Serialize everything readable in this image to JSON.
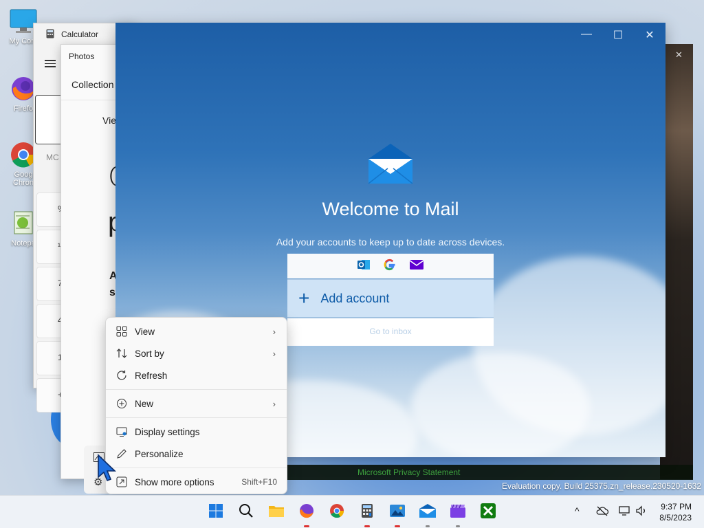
{
  "desktop": {
    "icons": [
      {
        "label": "My Com",
        "icon": "computer-icon"
      },
      {
        "label": "Firefo",
        "icon": "firefox-icon"
      },
      {
        "label": "Goog Chron",
        "icon": "chrome-icon"
      },
      {
        "label": "Notepa",
        "icon": "notepad-icon"
      }
    ],
    "watermark": "Evaluation copy. Build 25375.zn_release.230520-1632"
  },
  "calculator": {
    "title": "Calculator",
    "memory_label": "MC",
    "keys": [
      "%",
      "¹/x",
      "7",
      "4",
      "1",
      "+/-"
    ]
  },
  "photos": {
    "title": "Photos",
    "tab": "Collection",
    "view_label": "Vie",
    "big_c": "C",
    "big_p": "p",
    "line_a": "A",
    "line_s": "s"
  },
  "background_window": {
    "close": "✕",
    "privacy_link": "Microsoft Privacy Statement"
  },
  "mail": {
    "welcome": "Welcome to Mail",
    "subtitle": "Add your accounts to keep up to date across devices.",
    "providers": [
      "outlook-icon",
      "google-icon",
      "yahoo-mail-icon"
    ],
    "add_account": "Add account",
    "go_to_inbox": "Go to inbox",
    "controls": {
      "minimize": "—",
      "maximize": "☐",
      "close": "✕"
    }
  },
  "context_menu": {
    "items": [
      {
        "label": "View",
        "icon": "view-grid-icon",
        "submenu": true
      },
      {
        "label": "Sort by",
        "icon": "sort-icon",
        "submenu": true
      },
      {
        "label": "Refresh",
        "icon": "refresh-icon",
        "submenu": false
      },
      {
        "label": "New",
        "icon": "new-plus-icon",
        "submenu": true
      },
      {
        "label": "Display settings",
        "icon": "display-settings-icon",
        "submenu": false
      },
      {
        "label": "Personalize",
        "icon": "pen-icon",
        "submenu": false
      },
      {
        "label": "Show more options",
        "icon": "more-options-icon",
        "shortcut": "Shift+F10"
      }
    ]
  },
  "taskbar": {
    "apps": [
      "start-icon",
      "search-icon",
      "file-explorer-icon",
      "firefox-icon",
      "chrome-icon",
      "calculator-icon",
      "photos-icon",
      "mail-icon",
      "clipchamp-icon",
      "xbox-icon"
    ],
    "tray": {
      "chevron": "^"
    },
    "time": "9:37 PM",
    "date": "8/5/2023"
  }
}
